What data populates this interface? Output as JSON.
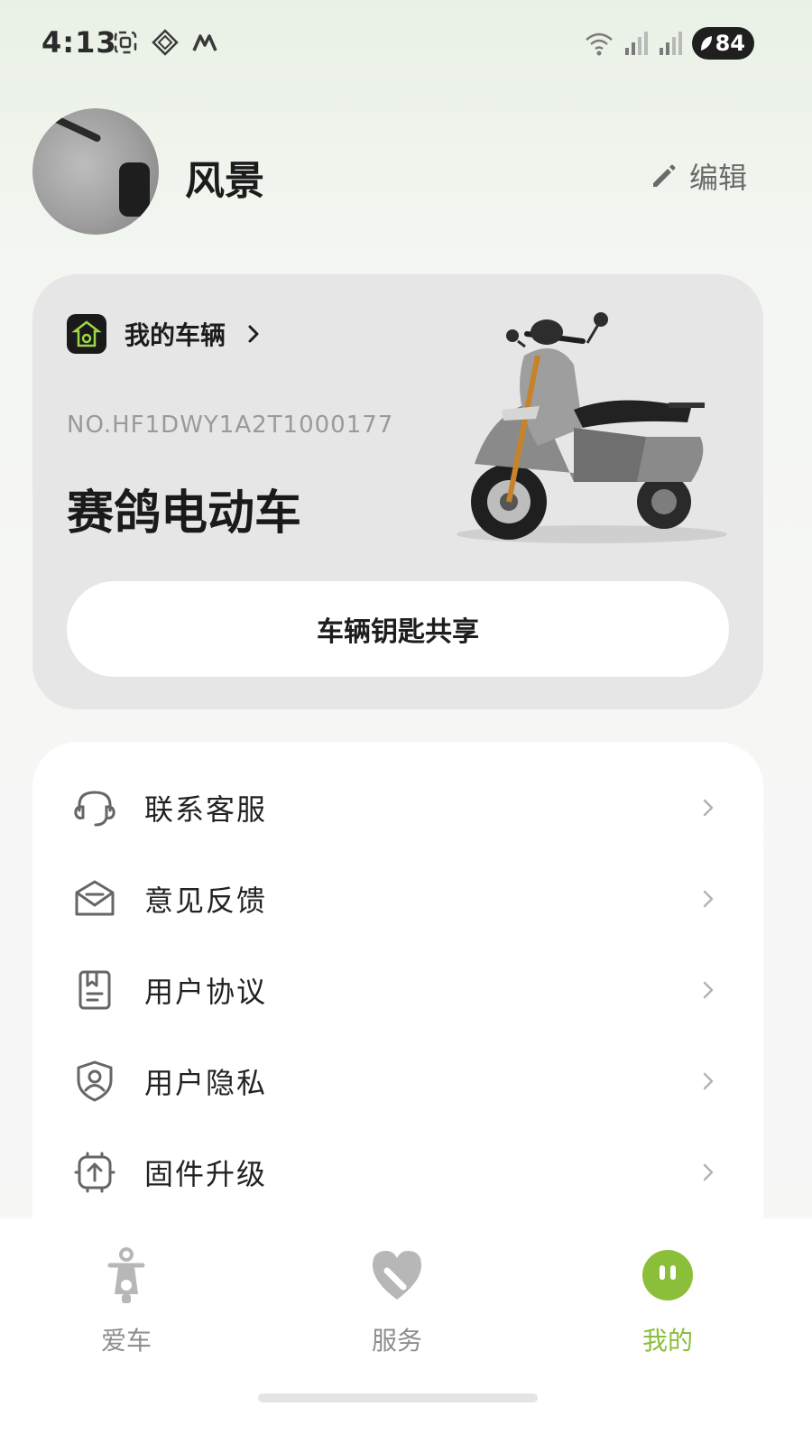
{
  "status_bar": {
    "time": "4:13",
    "battery": "84",
    "icons_left": [
      "screenshot-icon",
      "tile-icon",
      "m-logo-icon"
    ],
    "icons_right": [
      "wifi-icon",
      "signal-icon",
      "signal-icon"
    ]
  },
  "profile": {
    "name": "风景",
    "edit_label": "编辑"
  },
  "vehicle": {
    "section_title": "我的车辆",
    "number": "NO.HF1DWY1A2T1000177",
    "model": "赛鸽电动车",
    "share_button": "车辆钥匙共享"
  },
  "menu": {
    "items": [
      {
        "label": "联系客服",
        "icon": "headset-icon"
      },
      {
        "label": "意见反馈",
        "icon": "mail-icon"
      },
      {
        "label": "用户协议",
        "icon": "document-icon"
      },
      {
        "label": "用户隐私",
        "icon": "shield-user-icon"
      },
      {
        "label": "固件升级",
        "icon": "upgrade-chip-icon"
      }
    ]
  },
  "nav": {
    "items": [
      {
        "label": "爱车",
        "icon": "scooter-icon",
        "active": false
      },
      {
        "label": "服务",
        "icon": "heart-icon",
        "active": false
      },
      {
        "label": "我的",
        "icon": "profile-face-icon",
        "active": true
      }
    ]
  },
  "colors": {
    "accent": "#8bbf3a",
    "card_bg": "#e6e6e6",
    "inactive": "#8d8d8d"
  }
}
